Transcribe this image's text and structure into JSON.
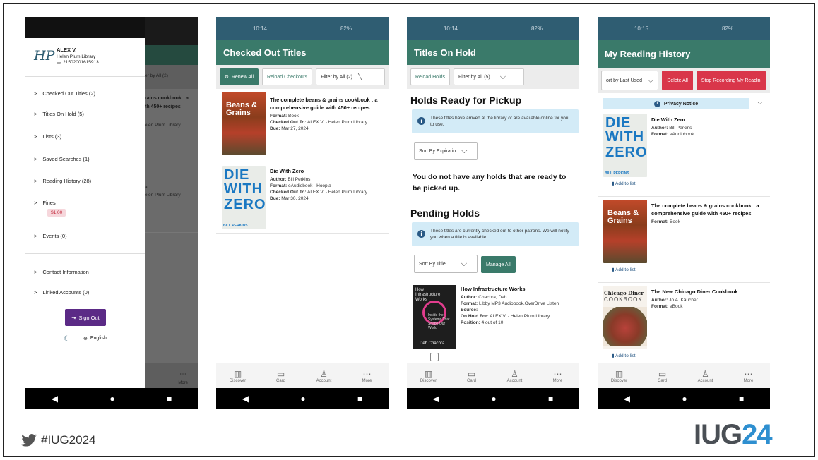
{
  "phone1": {
    "user_name": "ALEX V.",
    "library": "Helen Plum Library",
    "card_number": "21502001615913",
    "logo_text": "HP",
    "menu": [
      {
        "label": "Checked Out Titles (2)"
      },
      {
        "label": "Titles On Hold (5)"
      },
      {
        "label": "Lists (3)"
      },
      {
        "label": "Saved Searches (1)"
      },
      {
        "label": "Reading History (28)"
      },
      {
        "label": "Fines"
      },
      {
        "label": "Events (0)"
      }
    ],
    "fines_amount": "$1.00",
    "menu2": [
      {
        "label": "Contact Information"
      },
      {
        "label": "Linked Accounts (0)"
      }
    ],
    "sign_out": "Sign Out",
    "language": "English",
    "bg_filter": "er by All (2)",
    "bg_title1": "rains cookbook : a",
    "bg_title2": "th 450+ recipes",
    "bg_lib1": "elen Plum Library",
    "bg_a": "a",
    "bg_lib2": "elen Plum Library",
    "bg_more": "More"
  },
  "phone2": {
    "status_time": "10:14",
    "status_battery": "82%",
    "title": "Checked Out Titles",
    "renew_all": "Renew All",
    "reload": "Reload Checkouts",
    "filter": "Filter by All (2)",
    "items": [
      {
        "title": "The complete beans & grains cookbook : a comprehensive guide with 450+ recipes",
        "format": "Book",
        "checked_out_to": "ALEX V. - Helen Plum Library",
        "due": "Mar 27, 2024"
      },
      {
        "title": "Die With Zero",
        "author": "Bill Perkins",
        "format": "eAudiobook - Hoopla",
        "checked_out_to": "ALEX V. - Helen Plum Library",
        "due": "Mar 30, 2024"
      }
    ]
  },
  "phone3": {
    "status_time": "10:14",
    "status_battery": "82%",
    "title": "Titles On Hold",
    "reload": "Reload Holds",
    "filter": "Filter by All (5)",
    "ready_heading": "Holds Ready for Pickup",
    "ready_notice": "These titles have arrived at the library or are available online for you to use.",
    "sort1": "Sort By Expiratio",
    "no_holds": "You do not have any holds that are ready to be picked up.",
    "pending_heading": "Pending Holds",
    "pending_notice": "These titles are currently checked out to other patrons. We will notify you when a title is available.",
    "sort2": "Sort By Title",
    "manage_all": "Manage All",
    "item": {
      "title": "How Infrastructure Works",
      "author": "Chachra, Deb",
      "format": "Libby MP3 Audiobook,OverDrive Listen",
      "source": "",
      "on_hold_for": "ALEX V. - Helen Plum Library",
      "position": "4 out of 10"
    }
  },
  "phone4": {
    "status_time": "10:15",
    "status_battery": "82%",
    "title": "My Reading History",
    "sort": "ort by Last Used",
    "delete_all": "Delete All",
    "stop_recording": "Stop Recording My Readin",
    "privacy": "Privacy Notice",
    "add_to_list": "Add to list",
    "items": [
      {
        "title": "Die With Zero",
        "author": "Bill Perkins",
        "format": "eAudiobook"
      },
      {
        "title": "The complete beans & grains cookbook : a comprehensive guide with 450+ recipes",
        "format": "Book"
      },
      {
        "title": "The New Chicago Diner Cookbook",
        "author": "Jo A. Kaucher",
        "format": "eBook"
      }
    ]
  },
  "tabs": {
    "discover": "Discover",
    "card": "Card",
    "account": "Account",
    "more": "More"
  },
  "labels": {
    "author": "Author:",
    "format": "Format:",
    "checked_out_to": "Checked Out To:",
    "due": "Due:",
    "source": "Source:",
    "on_hold_for": "On Hold For:",
    "position": "Position:"
  },
  "covers": {
    "beans_line1": "Beans &",
    "beans_line2": "Grains",
    "die_line1": "DIE",
    "die_line2": "WITH",
    "die_line3": "ZERO",
    "die_author": "BILL PERKINS",
    "die_tag1": "GETTING ALL YOU CAN",
    "die_tag2": "FROM YOUR MONEY",
    "die_tag3": "AND YOUR LIFE",
    "infra_title": "How Infrastructure Works",
    "infra_sub": "Inside the Systems That Shape Our World",
    "infra_author": "Deb Chachra",
    "diner_line1": "Chicago Diner",
    "diner_line2": "COOKBOOK"
  },
  "footer": {
    "hashtag": "#IUG2024",
    "logo_a": "IUG",
    "logo_b": "24"
  },
  "colors": {
    "header": "#2f5d72",
    "appbar": "#3a7a6a",
    "danger": "#d9364a",
    "notice": "#d3ebf7",
    "logo_blue": "#2e8fd0",
    "logo_gray": "#4a4f55"
  }
}
